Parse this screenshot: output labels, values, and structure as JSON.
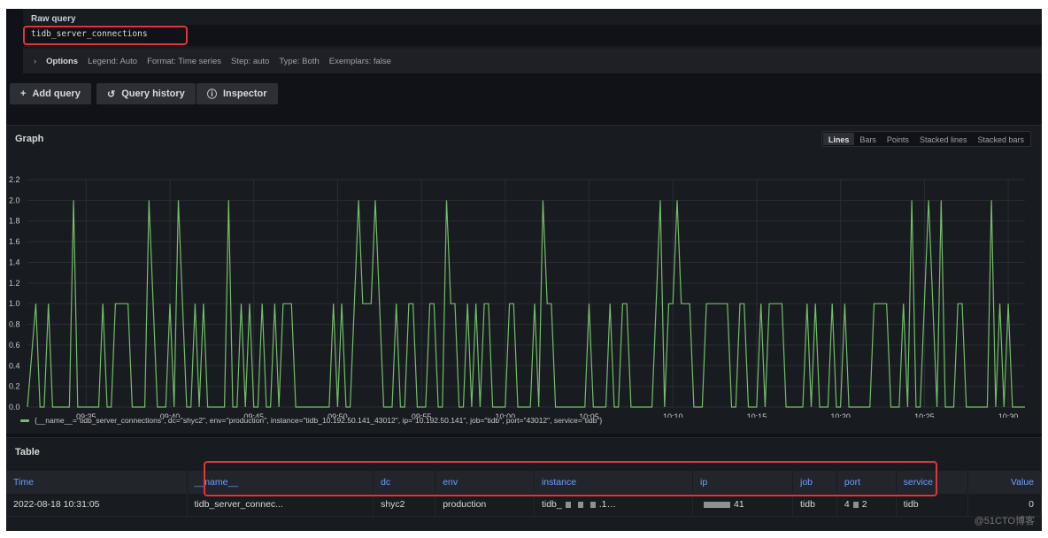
{
  "query": {
    "label": "Raw query",
    "value": "tidb_server_connections",
    "options": {
      "toggle": "Options",
      "legend": "Legend: Auto",
      "format": "Format: Time series",
      "step": "Step: auto",
      "type": "Type: Both",
      "exemplars": "Exemplars: false"
    }
  },
  "toolbar": {
    "add_query": "Add query",
    "query_history": "Query history",
    "inspector": "Inspector"
  },
  "graph": {
    "title": "Graph",
    "modes": [
      "Lines",
      "Bars",
      "Points",
      "Stacked lines",
      "Stacked bars"
    ],
    "active_mode": "Lines",
    "legend": "{__name__=\"tidb_server_connections\", dc=\"shyc2\", env=\"production\", instance=\"tidb_10.192.50.141_43012\", ip=\"10.192.50.141\", job=\"tidb\", port=\"43012\", service=\"tidb\"}"
  },
  "chart_data": {
    "type": "line",
    "title": "",
    "xlabel": "",
    "ylabel": "",
    "x_ticks": [
      "09:35",
      "09:40",
      "09:45",
      "09:50",
      "09:55",
      "10:00",
      "10:05",
      "10:10",
      "10:15",
      "10:20",
      "10:25",
      "10:30"
    ],
    "y_ticks": [
      "0.0",
      "0.2",
      "0.4",
      "0.6",
      "0.8",
      "1.0",
      "1.2",
      "1.4",
      "1.6",
      "1.8",
      "2.0",
      "2.2"
    ],
    "xlim": [
      "09:31:30",
      "10:31:00"
    ],
    "ylim": [
      0,
      2.2
    ],
    "grid": true,
    "legend_placement": "bottom-left",
    "series_color": "#73bf69",
    "series": [
      {
        "name": "{__name__=\"tidb_server_connections\", dc=\"shyc2\", env=\"production\", instance=\"tidb_10.192.50.141_43012\", ip=\"10.192.50.141\", job=\"tidb\", port=\"43012\", service=\"tidb\"}",
        "points": [
          [
            "09:31:30",
            0
          ],
          [
            "09:32:00",
            1
          ],
          [
            "09:32:15",
            0
          ],
          [
            "09:32:30",
            0
          ],
          [
            "09:32:45",
            1
          ],
          [
            "09:33:00",
            0
          ],
          [
            "09:34:00",
            0
          ],
          [
            "09:34:15",
            2
          ],
          [
            "09:34:30",
            0
          ],
          [
            "09:35:45",
            0
          ],
          [
            "09:36:00",
            1
          ],
          [
            "09:36:15",
            0
          ],
          [
            "09:36:30",
            0
          ],
          [
            "09:36:45",
            1
          ],
          [
            "09:37:30",
            1
          ],
          [
            "09:37:45",
            0
          ],
          [
            "09:38:30",
            0
          ],
          [
            "09:38:45",
            2
          ],
          [
            "09:39:15",
            0
          ],
          [
            "09:39:45",
            0
          ],
          [
            "09:40:00",
            1
          ],
          [
            "09:40:15",
            0
          ],
          [
            "09:40:30",
            2
          ],
          [
            "09:41:00",
            0
          ],
          [
            "09:41:15",
            0
          ],
          [
            "09:41:30",
            1
          ],
          [
            "09:41:45",
            0
          ],
          [
            "09:42:00",
            1
          ],
          [
            "09:42:15",
            0
          ],
          [
            "09:43:15",
            0
          ],
          [
            "09:43:30",
            2
          ],
          [
            "09:43:45",
            0
          ],
          [
            "09:44:00",
            0
          ],
          [
            "09:44:15",
            1
          ],
          [
            "09:44:30",
            0
          ],
          [
            "09:44:45",
            1
          ],
          [
            "09:45:00",
            0
          ],
          [
            "09:45:15",
            0
          ],
          [
            "09:45:30",
            1
          ],
          [
            "09:45:45",
            0
          ],
          [
            "09:46:00",
            0
          ],
          [
            "09:46:15",
            1
          ],
          [
            "09:46:30",
            0
          ],
          [
            "09:46:45",
            1
          ],
          [
            "09:47:15",
            1
          ],
          [
            "09:47:30",
            0
          ],
          [
            "09:49:30",
            0
          ],
          [
            "09:49:45",
            1
          ],
          [
            "09:50:00",
            0
          ],
          [
            "09:50:15",
            1
          ],
          [
            "09:50:30",
            0
          ],
          [
            "09:50:45",
            0
          ],
          [
            "09:51:15",
            2
          ],
          [
            "09:51:30",
            1
          ],
          [
            "09:52:00",
            1
          ],
          [
            "09:52:15",
            2
          ],
          [
            "09:52:45",
            0
          ],
          [
            "09:53:15",
            0
          ],
          [
            "09:53:30",
            1
          ],
          [
            "09:53:45",
            0
          ],
          [
            "09:54:00",
            0
          ],
          [
            "09:54:15",
            1
          ],
          [
            "09:54:30",
            1
          ],
          [
            "09:54:45",
            0
          ],
          [
            "09:55:15",
            0
          ],
          [
            "09:55:30",
            1
          ],
          [
            "09:55:45",
            1
          ],
          [
            "09:56:00",
            0
          ],
          [
            "09:56:15",
            0
          ],
          [
            "09:56:30",
            2
          ],
          [
            "09:56:45",
            1
          ],
          [
            "09:57:00",
            1
          ],
          [
            "09:57:15",
            0
          ],
          [
            "09:57:30",
            0
          ],
          [
            "09:57:45",
            1
          ],
          [
            "09:58:00",
            0
          ],
          [
            "09:58:15",
            1
          ],
          [
            "09:58:30",
            0
          ],
          [
            "09:58:45",
            1
          ],
          [
            "09:59:00",
            1
          ],
          [
            "09:59:15",
            0
          ],
          [
            "10:00:00",
            0
          ],
          [
            "10:00:15",
            1
          ],
          [
            "10:00:30",
            1
          ],
          [
            "10:00:45",
            0
          ],
          [
            "10:01:30",
            0
          ],
          [
            "10:01:45",
            1
          ],
          [
            "10:02:00",
            0
          ],
          [
            "10:02:15",
            2
          ],
          [
            "10:02:30",
            1
          ],
          [
            "10:02:45",
            1
          ],
          [
            "10:03:00",
            0
          ],
          [
            "10:04:45",
            0
          ],
          [
            "10:05:00",
            1
          ],
          [
            "10:05:15",
            0
          ],
          [
            "10:06:00",
            0
          ],
          [
            "10:06:15",
            1
          ],
          [
            "10:06:30",
            0
          ],
          [
            "10:06:45",
            0
          ],
          [
            "10:07:00",
            1
          ],
          [
            "10:07:15",
            1
          ],
          [
            "10:07:30",
            0
          ],
          [
            "10:08:45",
            0
          ],
          [
            "10:09:15",
            2
          ],
          [
            "10:09:30",
            0
          ],
          [
            "10:09:45",
            1
          ],
          [
            "10:10:00",
            1
          ],
          [
            "10:10:15",
            2
          ],
          [
            "10:10:30",
            1
          ],
          [
            "10:11:00",
            1
          ],
          [
            "10:11:15",
            0
          ],
          [
            "10:11:45",
            0
          ],
          [
            "10:12:00",
            1
          ],
          [
            "10:13:15",
            1
          ],
          [
            "10:13:30",
            0
          ],
          [
            "10:13:45",
            0
          ],
          [
            "10:14:00",
            1
          ],
          [
            "10:14:15",
            1
          ],
          [
            "10:14:30",
            0
          ],
          [
            "10:15:00",
            0
          ],
          [
            "10:15:15",
            1
          ],
          [
            "10:15:30",
            0
          ],
          [
            "10:15:45",
            1
          ],
          [
            "10:16:30",
            1
          ],
          [
            "10:16:45",
            0
          ],
          [
            "10:17:45",
            0
          ],
          [
            "10:18:00",
            1
          ],
          [
            "10:18:15",
            0
          ],
          [
            "10:18:30",
            1
          ],
          [
            "10:18:45",
            0
          ],
          [
            "10:19:15",
            0
          ],
          [
            "10:19:30",
            1
          ],
          [
            "10:19:45",
            0
          ],
          [
            "10:20:00",
            0
          ],
          [
            "10:20:15",
            1
          ],
          [
            "10:20:30",
            0
          ],
          [
            "10:21:45",
            0
          ],
          [
            "10:22:00",
            1
          ],
          [
            "10:22:45",
            1
          ],
          [
            "10:23:00",
            0
          ],
          [
            "10:23:30",
            0
          ],
          [
            "10:23:45",
            1
          ],
          [
            "10:24:00",
            0
          ],
          [
            "10:24:15",
            2
          ],
          [
            "10:24:30",
            0
          ],
          [
            "10:24:45",
            0
          ],
          [
            "10:25:15",
            2
          ],
          [
            "10:25:45",
            0
          ],
          [
            "10:26:00",
            2
          ],
          [
            "10:26:15",
            0
          ],
          [
            "10:26:45",
            0
          ],
          [
            "10:27:00",
            1
          ],
          [
            "10:27:15",
            1
          ],
          [
            "10:27:30",
            0
          ],
          [
            "10:28:45",
            0
          ],
          [
            "10:29:00",
            2
          ],
          [
            "10:29:15",
            0
          ],
          [
            "10:29:30",
            1
          ],
          [
            "10:29:45",
            0
          ],
          [
            "10:30:00",
            1
          ],
          [
            "10:30:15",
            0
          ],
          [
            "10:31:00",
            0
          ]
        ]
      }
    ]
  },
  "table": {
    "title": "Table",
    "columns": [
      "Time",
      "__name__",
      "dc",
      "env",
      "instance",
      "ip",
      "job",
      "port",
      "service",
      "Value"
    ],
    "rows": [
      {
        "time": "2022-08-18 10:31:05",
        "name": "tidb_server_connec...",
        "dc": "shyc2",
        "env": "production",
        "instance_prefix": "tidb_",
        "instance_suffix": ".1…",
        "ip_suffix": "41",
        "port_prefix": "4",
        "port_suffix": "2",
        "job": "tidb",
        "service": "tidb",
        "value": "0"
      }
    ]
  },
  "watermark": "@51CTO博客",
  "colors": {
    "accent": "#73bf69",
    "header_text": "#6e9fff",
    "highlight": "#e0343f"
  }
}
